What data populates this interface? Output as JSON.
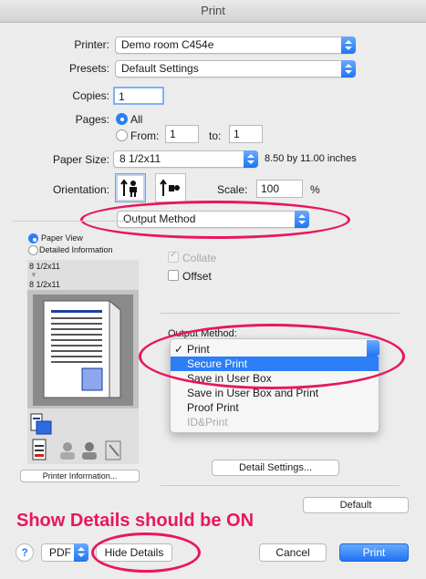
{
  "window": {
    "title": "Print"
  },
  "printer": {
    "label": "Printer:",
    "value": "Demo room C454e"
  },
  "presets": {
    "label": "Presets:",
    "value": "Default Settings"
  },
  "copies": {
    "label": "Copies:",
    "value": "1"
  },
  "pages": {
    "label": "Pages:",
    "all": "All",
    "from": "From:",
    "from_value": "1",
    "to": "to:",
    "to_value": "1"
  },
  "paper": {
    "label": "Paper Size:",
    "value": "8 1/2x11",
    "dimensions": "8.50 by 11.00 inches"
  },
  "orientation": {
    "label": "Orientation:"
  },
  "scale": {
    "label": "Scale:",
    "value": "100",
    "unit": "%"
  },
  "section": {
    "value": "Output Method"
  },
  "preview": {
    "paper_view": "Paper View",
    "detailed_info": "Detailed Information",
    "size1": "8 1/2x11",
    "size2": "8 1/2x11",
    "printer_info_button": "Printer Information..."
  },
  "options": {
    "collate": "Collate",
    "offset": "Offset",
    "output_method_label": "Output Method:"
  },
  "menu": {
    "items": [
      "Print",
      "Secure Print",
      "Save in User Box",
      "Save in User Box and Print",
      "Proof Print",
      "ID&Print"
    ],
    "checkmark": "✓"
  },
  "buttons": {
    "detail_settings": "Detail Settings...",
    "default": "Default",
    "help": "?",
    "pdf": "PDF",
    "hide_details": "Hide Details",
    "cancel": "Cancel",
    "print": "Print"
  },
  "annotation": {
    "text": "Show Details should be ON",
    "color": "#e8175d"
  },
  "colors": {
    "accent": "#2b7ef6"
  }
}
